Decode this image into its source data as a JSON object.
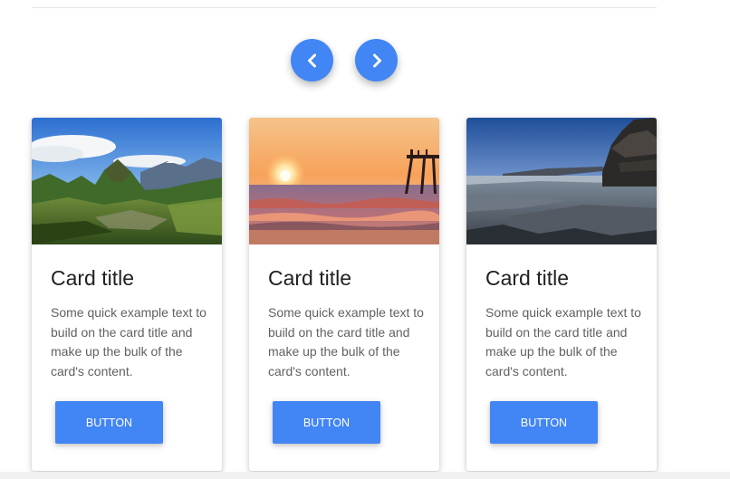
{
  "nav": {
    "prev_icon": "chevron-left-icon",
    "next_icon": "chevron-right-icon",
    "accent_color": "#4285f4"
  },
  "cards": [
    {
      "image": "mountain-ruins-landscape",
      "title": "Card title",
      "text": "Some quick example text to build on the card title and make up the bulk of the card's content.",
      "button": "BUTTON"
    },
    {
      "image": "sunset-beach-pier",
      "title": "Card title",
      "text": "Some quick example text to build on the card title and make up the bulk of the card's content.",
      "button": "BUTTON"
    },
    {
      "image": "rocky-coastline-cliff",
      "title": "Card title",
      "text": "Some quick example text to build on the card title and make up the bulk of the card's content.",
      "button": "BUTTON"
    }
  ]
}
